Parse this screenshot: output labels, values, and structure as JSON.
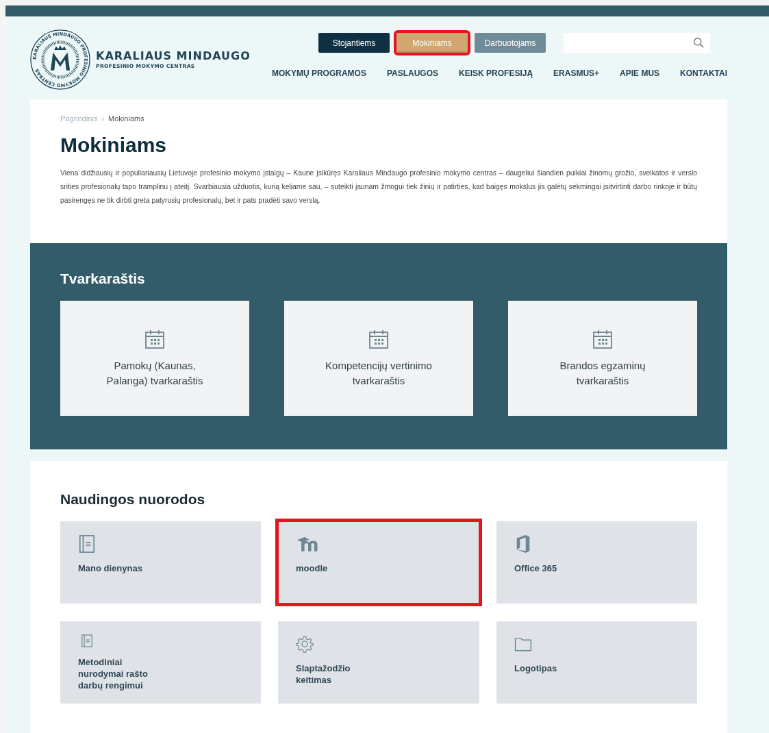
{
  "logo": {
    "seal_text": "KARALIAUS MINDAUGO PROFESINIO MOKYMO CENTRAS",
    "title": "KARALIAUS MINDAUGO",
    "subtitle": "PROFESINIO MOKYMO CENTRAS"
  },
  "audience_tabs": [
    {
      "label": "Stojantiems",
      "kind": "dark",
      "selected": false,
      "highlighted": false
    },
    {
      "label": "Mokiniams",
      "kind": "gold",
      "selected": true,
      "highlighted": true
    },
    {
      "label": "Darbuotojams",
      "kind": "grey",
      "selected": false,
      "highlighted": false
    }
  ],
  "main_nav": [
    "MOKYMŲ PROGRAMOS",
    "PASLAUGOS",
    "KEISK PROFESIJĄ",
    "ERASMUS+",
    "APIE MUS",
    "KONTAKTAI"
  ],
  "breadcrumb": [
    "Pagrindinis",
    "Mokiniams"
  ],
  "breadcrumb_separator": "›",
  "page_title": "Mokiniams",
  "intro": "Viena didžiausių ir populiariausių Lietuvoje profesinio mokymo įstaigų – Kaune įsikūręs Karaliaus Mindaugo profesinio mokymo centras – daugeliui šiandien puikiai žinomų grožio, sveikatos ir verslo srities profesionalų tapo tramplinu į ateitį. Svarbiausia užduotis, kurią keliame sau, – suteikti jaunam žmogui tiek žinių ir patirties, kad baigęs mokslus jis galėtų sėkmingai įsitvirtinti darbo rinkoje ir būtų pasirengęs ne tik dirbti greta patyrusių profesionalų, bet ir pats pradėti savo verslą.",
  "schedule": {
    "title": "Tvarkaraštis",
    "cards": [
      {
        "lines": [
          "Pamokų (Kaunas,",
          "Palanga) tvarkaraštis"
        ]
      },
      {
        "lines": [
          "Kompetencijų vertinimo",
          "tvarkaraštis"
        ]
      },
      {
        "lines": [
          "Brandos egzaminų",
          "tvarkaraštis"
        ]
      }
    ]
  },
  "links": {
    "title": "Naudingos nuorodos",
    "tiles": [
      {
        "kind": "book",
        "lines": [
          "Mano dienynas"
        ],
        "highlighted": false
      },
      {
        "kind": "moodle",
        "lines": [
          "moodle"
        ],
        "highlighted": true
      },
      {
        "kind": "office",
        "lines": [
          "Office 365"
        ],
        "highlighted": false
      },
      {
        "kind": "book",
        "lines": [
          "Metodiniai",
          "nurodymai rašto",
          "darbų rengimui"
        ],
        "highlighted": false
      },
      {
        "kind": "gear",
        "lines": [
          "Slaptažodžio",
          "keitimas"
        ],
        "highlighted": false
      },
      {
        "kind": "folder",
        "lines": [
          "Logotipas"
        ],
        "highlighted": false
      }
    ]
  }
}
